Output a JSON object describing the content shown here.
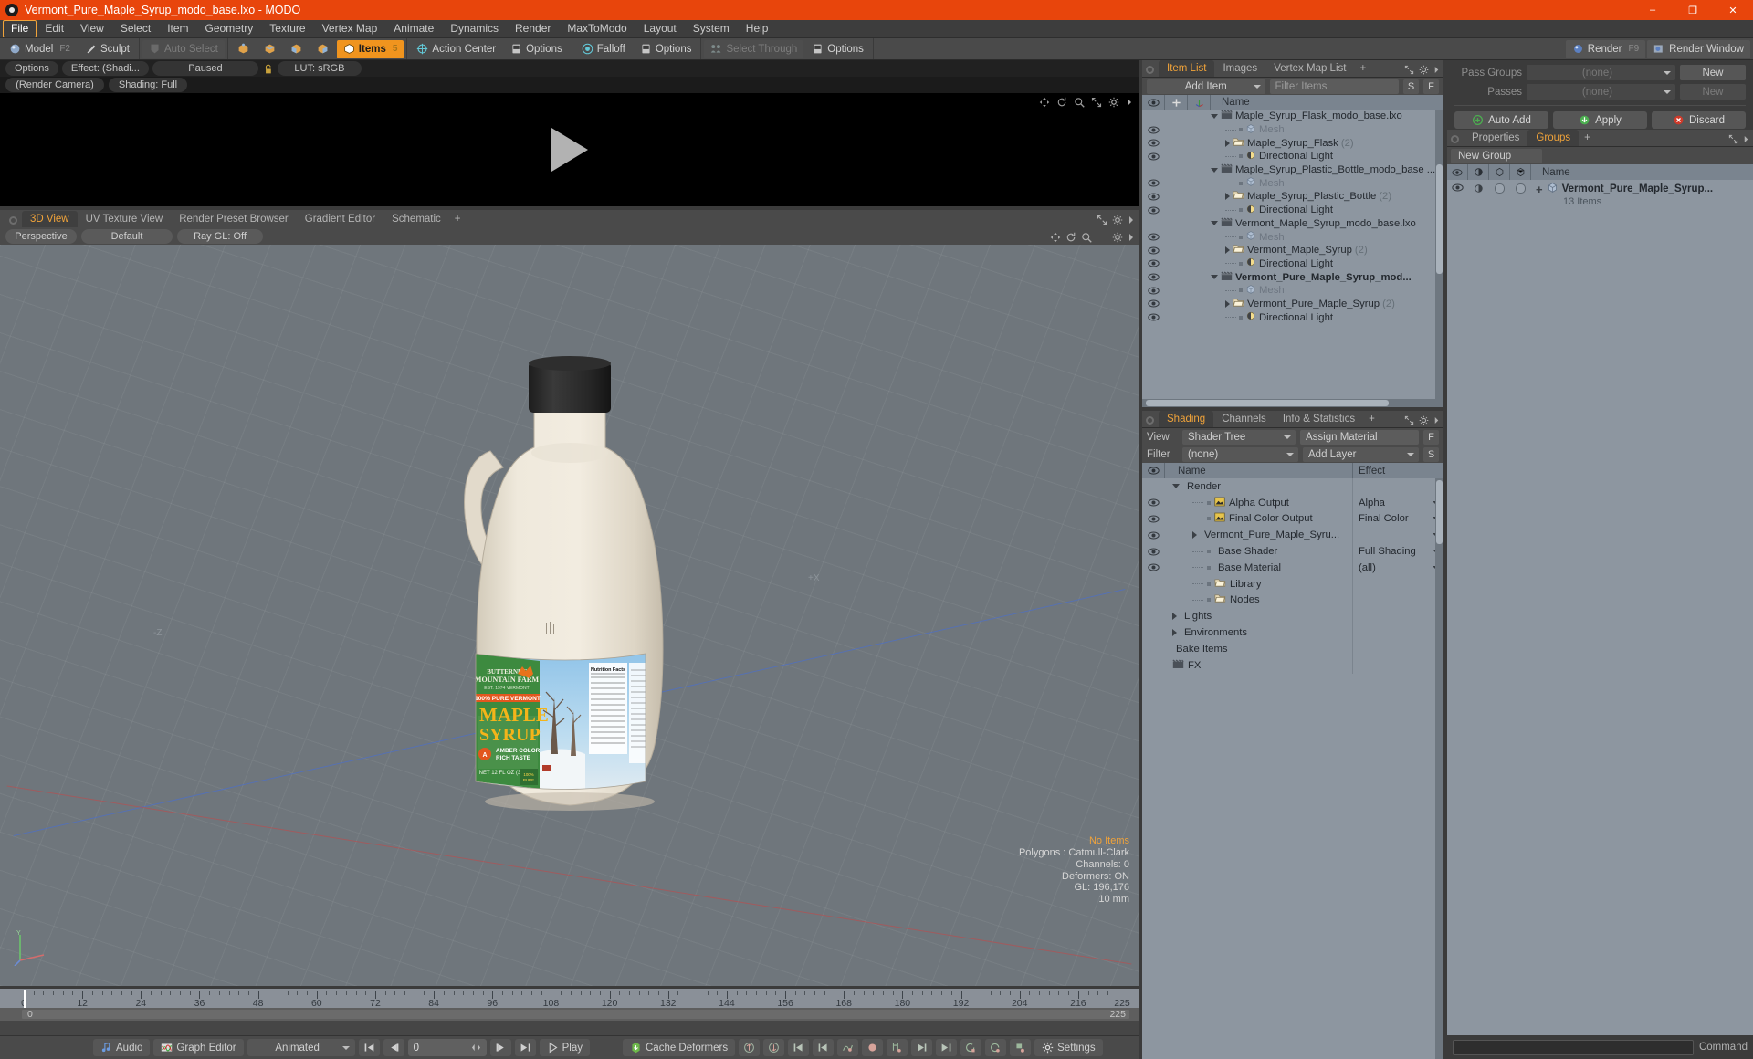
{
  "window": {
    "title": "Vermont_Pure_Maple_Syrup_modo_base.lxo - MODO",
    "minimize": "–",
    "maximize": "❐",
    "close": "✕"
  },
  "menubar": {
    "items": [
      "File",
      "Edit",
      "View",
      "Select",
      "Item",
      "Geometry",
      "Texture",
      "Vertex Map",
      "Animate",
      "Dynamics",
      "Render",
      "MaxToModo",
      "Layout",
      "System",
      "Help"
    ],
    "active": "File"
  },
  "toolbar": {
    "mode_model": "Model",
    "mode_model_key": "F2",
    "mode_sculpt": "Sculpt",
    "auto_select": "Auto Select",
    "items": "Items",
    "items_key": "5",
    "action_center": "Action Center",
    "options_1": "Options",
    "falloff": "Falloff",
    "options_2": "Options",
    "select_through": "Select Through",
    "options_3": "Options",
    "render": "Render",
    "render_key": "F9",
    "render_window": "Render Window"
  },
  "render_preview": {
    "options": "Options",
    "effect": "Effect: (Shadi...",
    "status": "Paused",
    "lut": "LUT: sRGB",
    "camera": "(Render Camera)",
    "shading": "Shading: Full"
  },
  "viewport": {
    "tabs": [
      "3D View",
      "UV Texture View",
      "Render Preset Browser",
      "Gradient Editor",
      "Schematic"
    ],
    "active_tab": "3D View",
    "plus": "+",
    "opt_projection": "Perspective",
    "opt_style": "Default",
    "opt_raygl": "Ray GL: Off",
    "axis_x_label": "+X",
    "axis_z_label": "-Z",
    "stats": {
      "selection": "No Items",
      "polygons": "Polygons : Catmull-Clark",
      "channels": "Channels: 0",
      "deformers": "Deformers: ON",
      "gl": "GL: 196,176",
      "scale": "10 mm"
    }
  },
  "timeline": {
    "ticks": [
      "0",
      "12",
      "24",
      "36",
      "48",
      "60",
      "72",
      "84",
      "96",
      "108",
      "120",
      "132",
      "144",
      "156",
      "168",
      "180",
      "192",
      "204",
      "216"
    ],
    "range_start": "0",
    "range_end": "225",
    "range_end_right": "225"
  },
  "bottombar": {
    "audio": "Audio",
    "graph_editor": "Graph Editor",
    "animated": "Animated",
    "frame": "0",
    "play": "Play",
    "cache_deformers": "Cache Deformers",
    "settings": "Settings"
  },
  "item_list": {
    "tabs": [
      "Item List",
      "Images",
      "Vertex Map List"
    ],
    "active_tab": "Item List",
    "plus": "+",
    "add_item": "Add Item",
    "filter_items": "Filter Items",
    "btn_s": "S",
    "btn_f": "F",
    "col_name": "Name",
    "rows": [
      {
        "indent": 0,
        "type": "scene",
        "label": "Maple_Syrup_Flask_modo_base.lxo",
        "count": "",
        "eye": false,
        "bold": false,
        "muted": false,
        "expander": "down"
      },
      {
        "indent": 1,
        "type": "mesh",
        "label": "Mesh",
        "count": "",
        "eye": true,
        "bold": false,
        "muted": true,
        "expander": "none"
      },
      {
        "indent": 1,
        "type": "group",
        "label": "Maple_Syrup_Flask",
        "count": "(2)",
        "eye": true,
        "bold": false,
        "muted": false,
        "expander": "right"
      },
      {
        "indent": 1,
        "type": "light",
        "label": "Directional Light",
        "count": "",
        "eye": true,
        "bold": false,
        "muted": false,
        "expander": "none"
      },
      {
        "indent": 0,
        "type": "scene",
        "label": "Maple_Syrup_Plastic_Bottle_modo_base ...",
        "count": "",
        "eye": false,
        "bold": false,
        "muted": false,
        "expander": "down"
      },
      {
        "indent": 1,
        "type": "mesh",
        "label": "Mesh",
        "count": "",
        "eye": true,
        "bold": false,
        "muted": true,
        "expander": "none"
      },
      {
        "indent": 1,
        "type": "group",
        "label": "Maple_Syrup_Plastic_Bottle",
        "count": "(2)",
        "eye": true,
        "bold": false,
        "muted": false,
        "expander": "right"
      },
      {
        "indent": 1,
        "type": "light",
        "label": "Directional Light",
        "count": "",
        "eye": true,
        "bold": false,
        "muted": false,
        "expander": "none"
      },
      {
        "indent": 0,
        "type": "scene",
        "label": "Vermont_Maple_Syrup_modo_base.lxo",
        "count": "",
        "eye": false,
        "bold": false,
        "muted": false,
        "expander": "down"
      },
      {
        "indent": 1,
        "type": "mesh",
        "label": "Mesh",
        "count": "",
        "eye": true,
        "bold": false,
        "muted": true,
        "expander": "none"
      },
      {
        "indent": 1,
        "type": "group",
        "label": "Vermont_Maple_Syrup",
        "count": "(2)",
        "eye": true,
        "bold": false,
        "muted": false,
        "expander": "right"
      },
      {
        "indent": 1,
        "type": "light",
        "label": "Directional Light",
        "count": "",
        "eye": true,
        "bold": false,
        "muted": false,
        "expander": "none"
      },
      {
        "indent": 0,
        "type": "scene",
        "label": "Vermont_Pure_Maple_Syrup_mod...",
        "count": "",
        "eye": true,
        "bold": true,
        "muted": false,
        "expander": "down"
      },
      {
        "indent": 1,
        "type": "mesh",
        "label": "Mesh",
        "count": "",
        "eye": true,
        "bold": false,
        "muted": true,
        "expander": "none"
      },
      {
        "indent": 1,
        "type": "group",
        "label": "Vermont_Pure_Maple_Syrup",
        "count": "(2)",
        "eye": true,
        "bold": false,
        "muted": false,
        "expander": "right"
      },
      {
        "indent": 1,
        "type": "light",
        "label": "Directional Light",
        "count": "",
        "eye": true,
        "bold": false,
        "muted": false,
        "expander": "none"
      }
    ]
  },
  "shading": {
    "tabs": [
      "Shading",
      "Channels",
      "Info & Statistics"
    ],
    "active_tab": "Shading",
    "plus": "+",
    "view_label": "View",
    "view_value": "Shader Tree",
    "assign_material": "Assign Material",
    "btn_f": "F",
    "filter_label": "Filter",
    "filter_value": "(none)",
    "add_layer": "Add Layer",
    "btn_s": "S",
    "col_name": "Name",
    "col_effect": "Effect",
    "rows": [
      {
        "indent": 0,
        "icon": "sphere-blue",
        "label": "Render",
        "effect": "",
        "eye": false,
        "expander": "down",
        "dropdown": false
      },
      {
        "indent": 1,
        "icon": "image",
        "label": "Alpha Output",
        "effect": "Alpha",
        "eye": true,
        "expander": "none",
        "dropdown": true
      },
      {
        "indent": 1,
        "icon": "image",
        "label": "Final Color Output",
        "effect": "Final Color",
        "eye": true,
        "expander": "none",
        "dropdown": true
      },
      {
        "indent": 1,
        "icon": "sphere-red",
        "label": "Vermont_Pure_Maple_Syru...",
        "effect": "",
        "eye": true,
        "expander": "right",
        "dropdown": true
      },
      {
        "indent": 1,
        "icon": "sphere-grey",
        "label": "Base Shader",
        "effect": "Full Shading",
        "eye": true,
        "expander": "none",
        "dropdown": true
      },
      {
        "indent": 1,
        "icon": "sphere-green",
        "label": "Base Material",
        "effect": "(all)",
        "eye": true,
        "expander": "none",
        "dropdown": true
      },
      {
        "indent": 1,
        "icon": "folder",
        "label": "Library",
        "effect": "",
        "eye": false,
        "expander": "none",
        "dropdown": false
      },
      {
        "indent": 1,
        "icon": "folder",
        "label": "Nodes",
        "effect": "",
        "eye": false,
        "expander": "none",
        "dropdown": false
      },
      {
        "indent": 0,
        "icon": "none",
        "label": "Lights",
        "effect": "",
        "eye": false,
        "expander": "right",
        "dropdown": false
      },
      {
        "indent": 0,
        "icon": "none",
        "label": "Environments",
        "effect": "",
        "eye": false,
        "expander": "right",
        "dropdown": false
      },
      {
        "indent": 0,
        "icon": "none",
        "label": "Bake Items",
        "effect": "",
        "eye": false,
        "expander": "none",
        "dropdown": false
      },
      {
        "indent": 0,
        "icon": "clapper",
        "label": "FX",
        "effect": "",
        "eye": false,
        "expander": "none",
        "dropdown": false
      }
    ]
  },
  "passes": {
    "pass_groups_label": "Pass Groups",
    "pass_groups_value": "(none)",
    "pass_groups_new": "New",
    "passes_label": "Passes",
    "passes_value": "(none)",
    "passes_new": "New",
    "auto_add": "Auto Add",
    "apply": "Apply",
    "discard": "Discard"
  },
  "groups": {
    "tabs": [
      "Properties",
      "Groups"
    ],
    "active_tab": "Groups",
    "plus": "+",
    "new_group": "New Group",
    "col_name": "Name",
    "rows": [
      {
        "name": "Vermont_Pure_Maple_Syrup...",
        "sub": "13 Items",
        "expander": "+"
      }
    ]
  },
  "command": {
    "label": "Command",
    "value": ""
  },
  "colors": {
    "title_bar": "#e8450c",
    "accent": "#f0a33a",
    "panel_bg": "#3f3f3f",
    "list_bg": "#8d96a0",
    "viewport_bg": "#6f767c"
  }
}
